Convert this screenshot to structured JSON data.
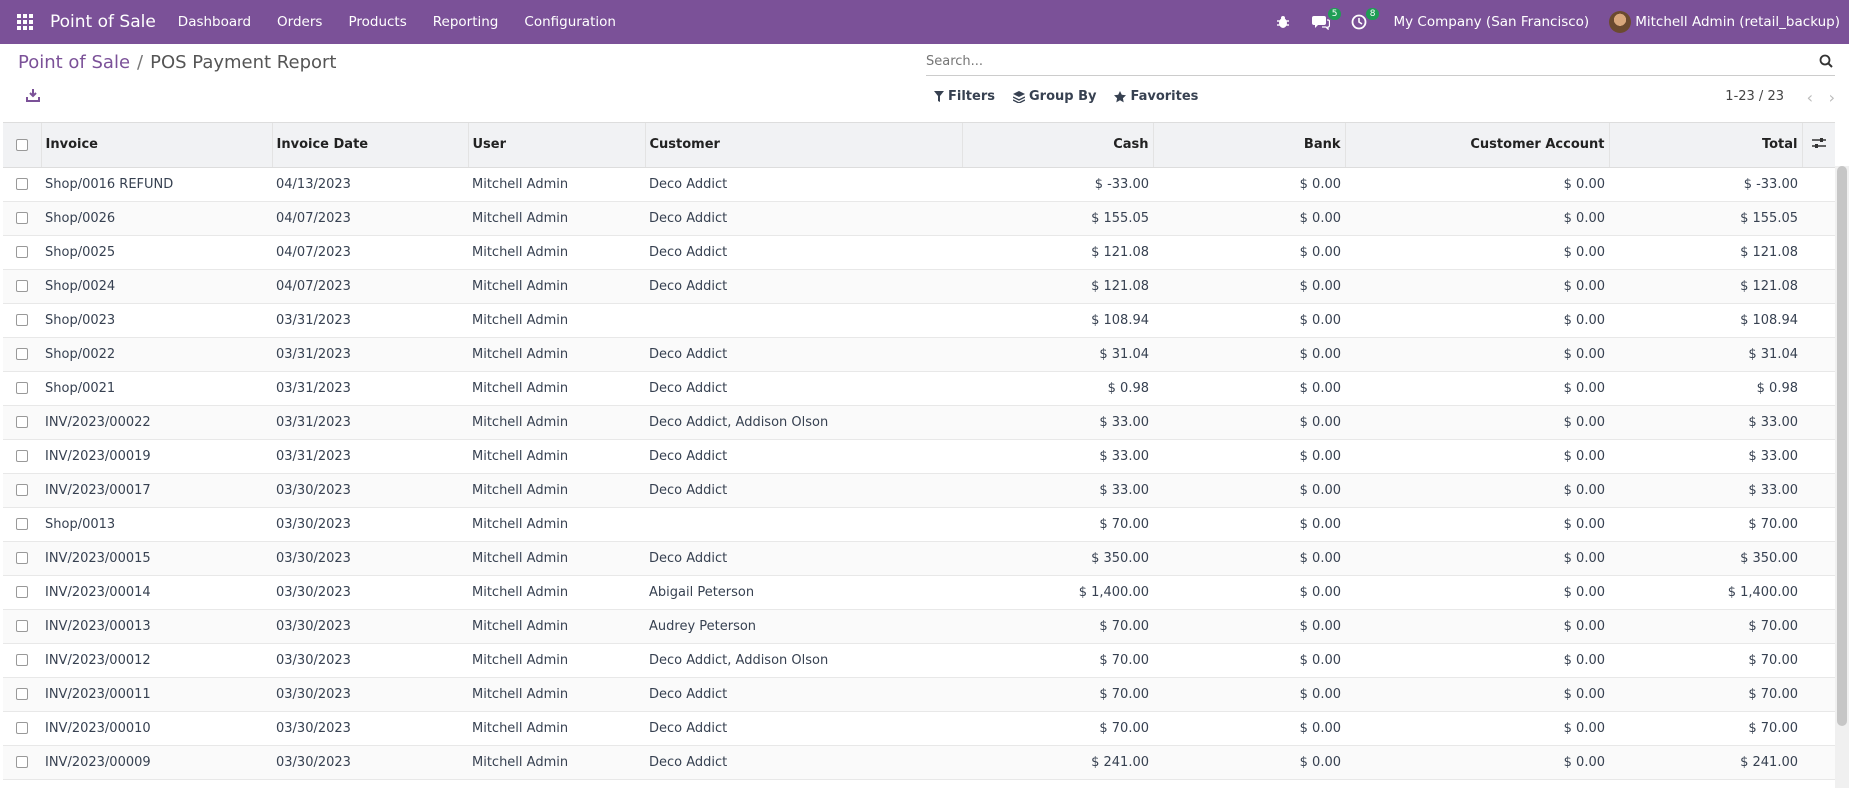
{
  "navbar": {
    "brand": "Point of Sale",
    "menu": [
      "Dashboard",
      "Orders",
      "Products",
      "Reporting",
      "Configuration"
    ],
    "messages_count": "5",
    "activities_count": "8",
    "company": "My Company (San Francisco)",
    "user": "Mitchell Admin (retail_backup)",
    "colors": {
      "bar": "#7B5198",
      "badge": "#1f9d55"
    }
  },
  "breadcrumb": {
    "parent": "Point of Sale",
    "separator": "/",
    "current": "POS Payment Report"
  },
  "search": {
    "placeholder": "Search..."
  },
  "toolbar": {
    "filters": "Filters",
    "group_by": "Group By",
    "favorites": "Favorites",
    "pager": "1-23 / 23"
  },
  "table": {
    "columns": [
      "Invoice",
      "Invoice Date",
      "User",
      "Customer",
      "Cash",
      "Bank",
      "Customer Account",
      "Total"
    ],
    "rows": [
      [
        "Shop/0016 REFUND",
        "04/13/2023",
        "Mitchell Admin",
        "Deco Addict",
        "$ -33.00",
        "$ 0.00",
        "$ 0.00",
        "$ -33.00"
      ],
      [
        "Shop/0026",
        "04/07/2023",
        "Mitchell Admin",
        "Deco Addict",
        "$ 155.05",
        "$ 0.00",
        "$ 0.00",
        "$ 155.05"
      ],
      [
        "Shop/0025",
        "04/07/2023",
        "Mitchell Admin",
        "Deco Addict",
        "$ 121.08",
        "$ 0.00",
        "$ 0.00",
        "$ 121.08"
      ],
      [
        "Shop/0024",
        "04/07/2023",
        "Mitchell Admin",
        "Deco Addict",
        "$ 121.08",
        "$ 0.00",
        "$ 0.00",
        "$ 121.08"
      ],
      [
        "Shop/0023",
        "03/31/2023",
        "Mitchell Admin",
        "",
        "$ 108.94",
        "$ 0.00",
        "$ 0.00",
        "$ 108.94"
      ],
      [
        "Shop/0022",
        "03/31/2023",
        "Mitchell Admin",
        "Deco Addict",
        "$ 31.04",
        "$ 0.00",
        "$ 0.00",
        "$ 31.04"
      ],
      [
        "Shop/0021",
        "03/31/2023",
        "Mitchell Admin",
        "Deco Addict",
        "$ 0.98",
        "$ 0.00",
        "$ 0.00",
        "$ 0.98"
      ],
      [
        "INV/2023/00022",
        "03/31/2023",
        "Mitchell Admin",
        "Deco Addict, Addison Olson",
        "$ 33.00",
        "$ 0.00",
        "$ 0.00",
        "$ 33.00"
      ],
      [
        "INV/2023/00019",
        "03/31/2023",
        "Mitchell Admin",
        "Deco Addict",
        "$ 33.00",
        "$ 0.00",
        "$ 0.00",
        "$ 33.00"
      ],
      [
        "INV/2023/00017",
        "03/30/2023",
        "Mitchell Admin",
        "Deco Addict",
        "$ 33.00",
        "$ 0.00",
        "$ 0.00",
        "$ 33.00"
      ],
      [
        "Shop/0013",
        "03/30/2023",
        "Mitchell Admin",
        "",
        "$ 70.00",
        "$ 0.00",
        "$ 0.00",
        "$ 70.00"
      ],
      [
        "INV/2023/00015",
        "03/30/2023",
        "Mitchell Admin",
        "Deco Addict",
        "$ 350.00",
        "$ 0.00",
        "$ 0.00",
        "$ 350.00"
      ],
      [
        "INV/2023/00014",
        "03/30/2023",
        "Mitchell Admin",
        "Abigail Peterson",
        "$ 1,400.00",
        "$ 0.00",
        "$ 0.00",
        "$ 1,400.00"
      ],
      [
        "INV/2023/00013",
        "03/30/2023",
        "Mitchell Admin",
        "Audrey Peterson",
        "$ 70.00",
        "$ 0.00",
        "$ 0.00",
        "$ 70.00"
      ],
      [
        "INV/2023/00012",
        "03/30/2023",
        "Mitchell Admin",
        "Deco Addict, Addison Olson",
        "$ 70.00",
        "$ 0.00",
        "$ 0.00",
        "$ 70.00"
      ],
      [
        "INV/2023/00011",
        "03/30/2023",
        "Mitchell Admin",
        "Deco Addict",
        "$ 70.00",
        "$ 0.00",
        "$ 0.00",
        "$ 70.00"
      ],
      [
        "INV/2023/00010",
        "03/30/2023",
        "Mitchell Admin",
        "Deco Addict",
        "$ 70.00",
        "$ 0.00",
        "$ 0.00",
        "$ 70.00"
      ],
      [
        "INV/2023/00009",
        "03/30/2023",
        "Mitchell Admin",
        "Deco Addict",
        "$ 241.00",
        "$ 0.00",
        "$ 0.00",
        "$ 241.00"
      ]
    ]
  }
}
